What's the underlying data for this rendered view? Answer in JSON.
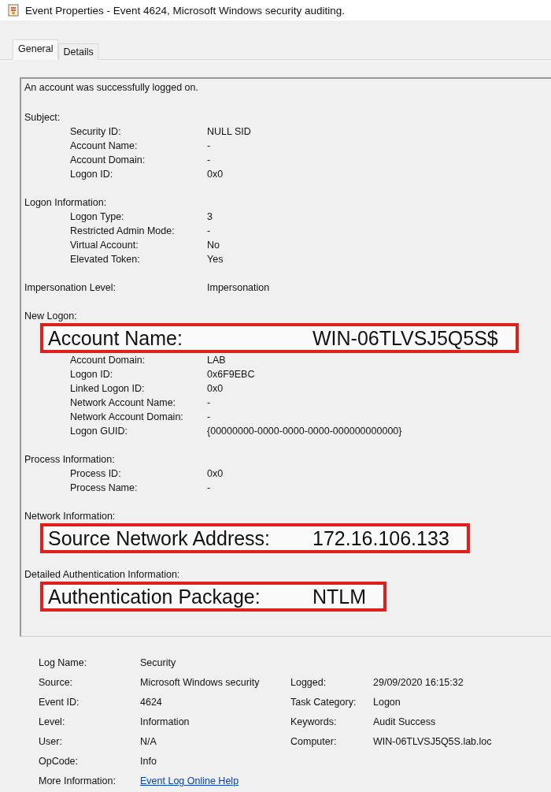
{
  "window": {
    "title": "Event Properties - Event 4624, Microsoft Windows security auditing."
  },
  "tabs": [
    {
      "label": "General",
      "selected": true
    },
    {
      "label": "Details",
      "selected": false
    }
  ],
  "description": [
    {
      "kind": "sentence",
      "text": "An account was successfully logged on."
    },
    {
      "kind": "section",
      "title": "Subject:",
      "rows": [
        {
          "label": "Security ID:",
          "value": "NULL SID",
          "highlighted": false
        },
        {
          "label": "Account Name:",
          "value": "-",
          "highlighted": false
        },
        {
          "label": "Account Domain:",
          "value": "-",
          "highlighted": false
        },
        {
          "label": "Logon ID:",
          "value": "0x0",
          "highlighted": false
        }
      ]
    },
    {
      "kind": "section",
      "title": "Logon Information:",
      "rows": [
        {
          "label": "Logon Type:",
          "value": "3",
          "highlighted": false
        },
        {
          "label": "Restricted Admin Mode:",
          "value": "-",
          "highlighted": false
        },
        {
          "label": "Virtual Account:",
          "value": "No",
          "highlighted": false
        },
        {
          "label": "Elevated Token:",
          "value": "Yes",
          "highlighted": false
        }
      ]
    },
    {
      "kind": "field",
      "label": "Impersonation Level:",
      "value": "Impersonation"
    },
    {
      "kind": "section",
      "title": "New Logon:",
      "rows": [
        {
          "label": "Account Name:",
          "value": "WIN-06TLVSJ5Q5S$",
          "highlighted": true
        },
        {
          "label": "Account Domain:",
          "value": "LAB",
          "highlighted": false
        },
        {
          "label": "Logon ID:",
          "value": "0x6F9EBC",
          "highlighted": false
        },
        {
          "label": "Linked Logon ID:",
          "value": "0x0",
          "highlighted": false
        },
        {
          "label": "Network Account Name:",
          "value": "-",
          "highlighted": false
        },
        {
          "label": "Network Account Domain:",
          "value": "-",
          "highlighted": false
        },
        {
          "label": "Logon GUID:",
          "value": "{00000000-0000-0000-0000-000000000000}",
          "highlighted": false
        }
      ]
    },
    {
      "kind": "section",
      "title": "Process Information:",
      "rows": [
        {
          "label": "Process ID:",
          "value": "0x0",
          "highlighted": false
        },
        {
          "label": "Process Name:",
          "value": "-",
          "highlighted": false
        }
      ]
    },
    {
      "kind": "section",
      "title": "Network Information:",
      "rows": [
        {
          "label": "Source Network Address:",
          "value": "172.16.106.133",
          "highlighted": true
        }
      ]
    },
    {
      "kind": "section",
      "title": "Detailed Authentication Information:",
      "rows": [
        {
          "label": "Authentication Package:",
          "value": "NTLM",
          "highlighted": true
        }
      ]
    }
  ],
  "properties": [
    {
      "label": "Log Name:",
      "value": "Security"
    },
    {
      "label": "Source:",
      "value": "Microsoft Windows security",
      "label_2": "Logged:",
      "value_2": "29/09/2020 16:15:32"
    },
    {
      "label": "Event ID:",
      "value": "4624",
      "label_2": "Task Category:",
      "value_2": "Logon"
    },
    {
      "label": "Level:",
      "value": "Information",
      "label_2": "Keywords:",
      "value_2": "Audit Success"
    },
    {
      "label": "User:",
      "value": "N/A",
      "label_2": "Computer:",
      "value_2": "WIN-06TLVSJ5Q5S.lab.loc"
    },
    {
      "label": "OpCode:",
      "value": "Info"
    },
    {
      "label": "More Information:",
      "link": "Event Log Online Help"
    }
  ]
}
